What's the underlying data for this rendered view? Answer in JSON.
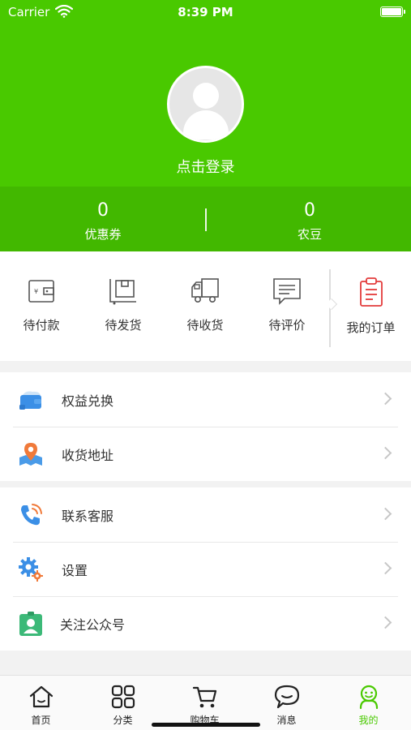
{
  "status_bar": {
    "carrier": "Carrier",
    "time": "8:39 PM"
  },
  "profile": {
    "login_text": "点击登录"
  },
  "stats": [
    {
      "value": "0",
      "label": "优惠券"
    },
    {
      "value": "0",
      "label": "农豆"
    }
  ],
  "orders": {
    "items": [
      {
        "label": "待付款",
        "icon": "wallet-icon"
      },
      {
        "label": "待发货",
        "icon": "package-icon"
      },
      {
        "label": "待收货",
        "icon": "truck-icon"
      },
      {
        "label": "待评价",
        "icon": "comment-icon"
      }
    ],
    "my_orders": {
      "label": "我的订单",
      "icon": "clipboard-icon"
    }
  },
  "menu_groups": [
    [
      {
        "label": "权益兑换",
        "icon": "card-icon"
      },
      {
        "label": "收货地址",
        "icon": "map-pin-icon"
      }
    ],
    [
      {
        "label": "联系客服",
        "icon": "phone-icon"
      },
      {
        "label": "设置",
        "icon": "gear-icon"
      },
      {
        "label": "关注公众号",
        "icon": "badge-icon"
      }
    ]
  ],
  "tabbar": {
    "tabs": [
      {
        "label": "首页",
        "icon": "home-icon"
      },
      {
        "label": "分类",
        "icon": "grid-icon"
      },
      {
        "label": "购物车",
        "icon": "cart-icon"
      },
      {
        "label": "消息",
        "icon": "chat-icon"
      },
      {
        "label": "我的",
        "icon": "profile-icon",
        "active": true
      }
    ]
  },
  "colors": {
    "brand_green": "#49c900",
    "stats_green": "#42b800",
    "order_red": "#e33b3b"
  }
}
